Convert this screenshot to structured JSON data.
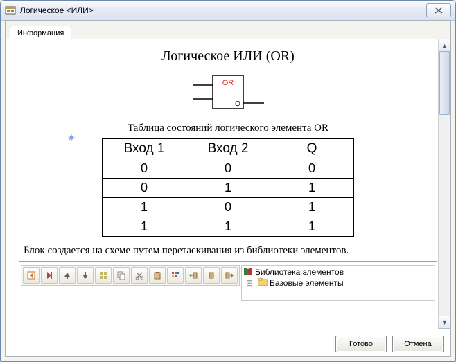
{
  "window": {
    "title": "Логическое <ИЛИ>"
  },
  "tab": {
    "label": "Информация"
  },
  "content": {
    "heading": "Логическое  ИЛИ (OR)",
    "gate_label": "OR",
    "gate_output": "Q",
    "table_caption": "Таблица  состояний  логического  элемента  OR",
    "columns": [
      "Вход 1",
      "Вход 2",
      "Q"
    ],
    "rows": [
      [
        "0",
        "0",
        "0"
      ],
      [
        "0",
        "1",
        "1"
      ],
      [
        "1",
        "0",
        "1"
      ],
      [
        "1",
        "1",
        "1"
      ]
    ],
    "description": "Блок  создается  на  схеме  путем  перетаскивания  из  библиотеки  элементов."
  },
  "tree": {
    "root": "Библиотека элементов",
    "child": "Базовые элементы"
  },
  "buttons": {
    "ok": "Готово",
    "cancel": "Отмена"
  }
}
